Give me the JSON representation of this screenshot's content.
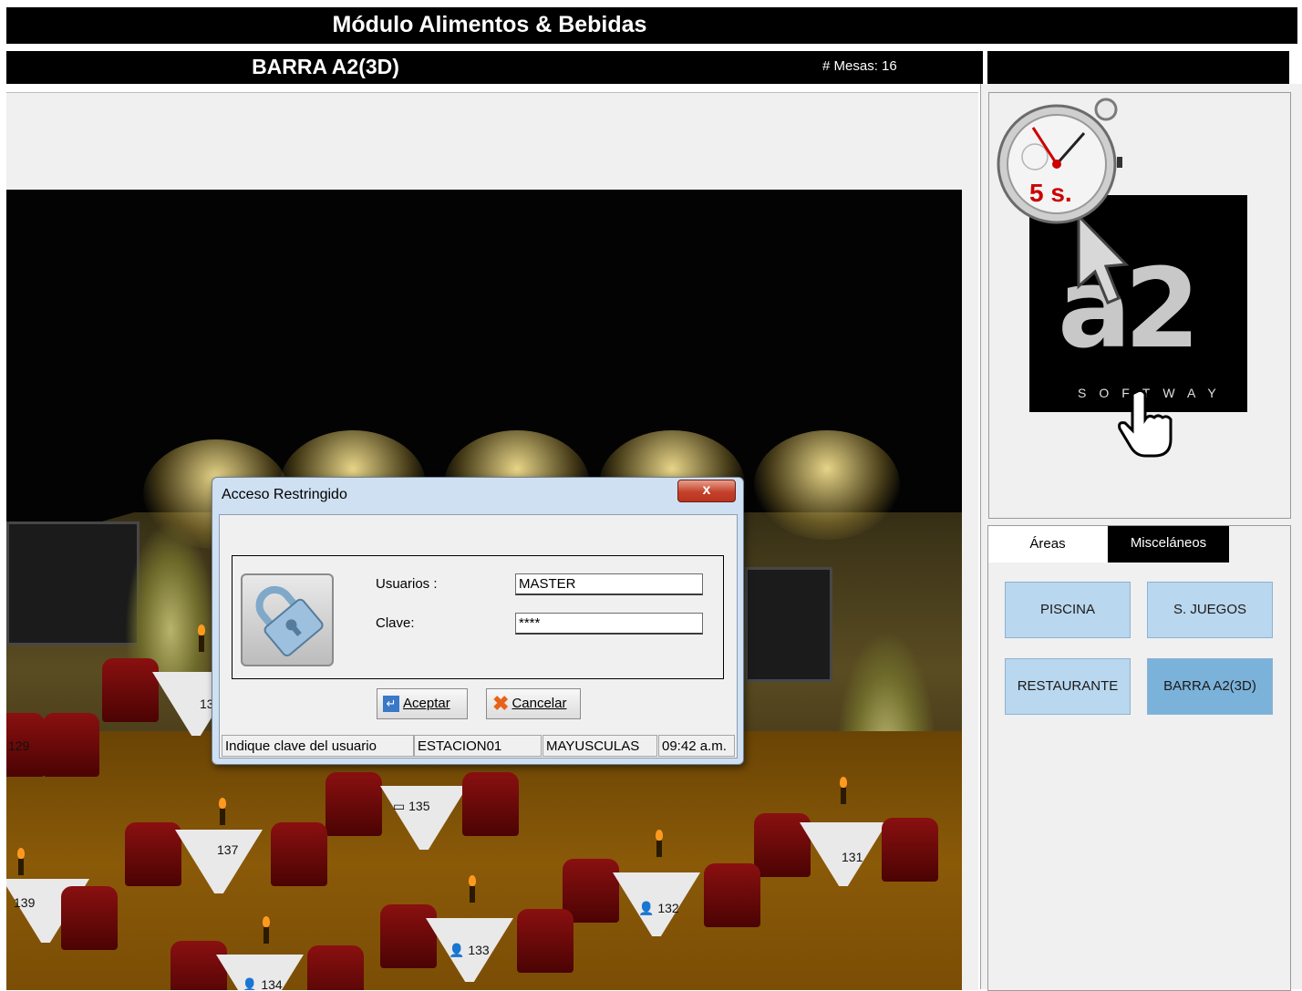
{
  "app": {
    "title": "Módulo Alimentos & Bebidas"
  },
  "area_header": {
    "title": "BARRA A2(3D)",
    "mesas": "# Mesas: 16"
  },
  "logo": {
    "stopwatch_label": "5 s.",
    "brand": "a2",
    "sub": "SOFTWAY"
  },
  "tabs": [
    {
      "label": "Áreas"
    },
    {
      "label": "Misceláneos"
    }
  ],
  "areas": [
    {
      "label": "PISCINA"
    },
    {
      "label": "S. JUEGOS"
    },
    {
      "label": "RESTAURANTE"
    },
    {
      "label": "BARRA A2(3D)",
      "active": true
    }
  ],
  "tables": [
    "129",
    "13",
    "135",
    "137",
    "131",
    "139",
    "132",
    "133",
    "134"
  ],
  "dialog": {
    "title": "Acceso Restringido",
    "close": "x",
    "usuarios_label": "Usuarios :",
    "usuarios_value": "MASTER",
    "clave_label": "Clave:",
    "clave_value": "****",
    "accept_label": "Aceptar",
    "cancel_label": "Cancelar",
    "status": {
      "message": "Indique clave del usuario",
      "station": "ESTACION01",
      "caps": "MAYUSCULAS",
      "time": "09:42 a.m."
    }
  },
  "colors": {
    "area_button": "#b9d7ee",
    "area_button_active": "#7bb2da",
    "dialog_frame": "#cfe0f2"
  }
}
